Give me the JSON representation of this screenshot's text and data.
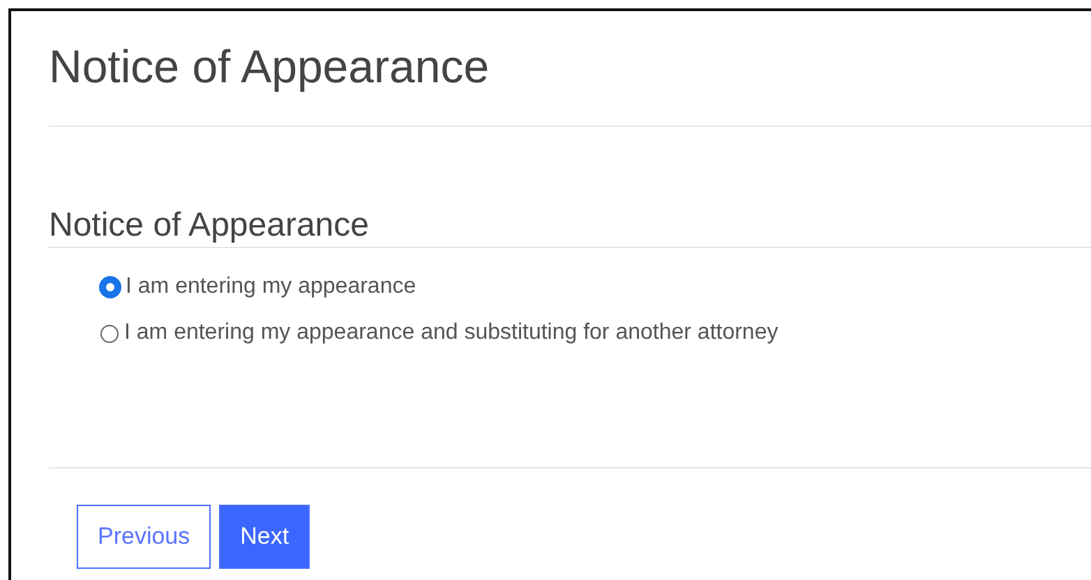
{
  "page": {
    "title": "Notice of Appearance"
  },
  "section": {
    "heading": "Notice of Appearance",
    "options": [
      {
        "label": "I am entering my appearance",
        "selected": true
      },
      {
        "label": "I am entering my appearance and substituting for another attorney",
        "selected": false
      }
    ]
  },
  "buttons": [
    {
      "label": "Previous",
      "kind": "secondary"
    },
    {
      "label": "Next",
      "kind": "primary"
    }
  ]
}
